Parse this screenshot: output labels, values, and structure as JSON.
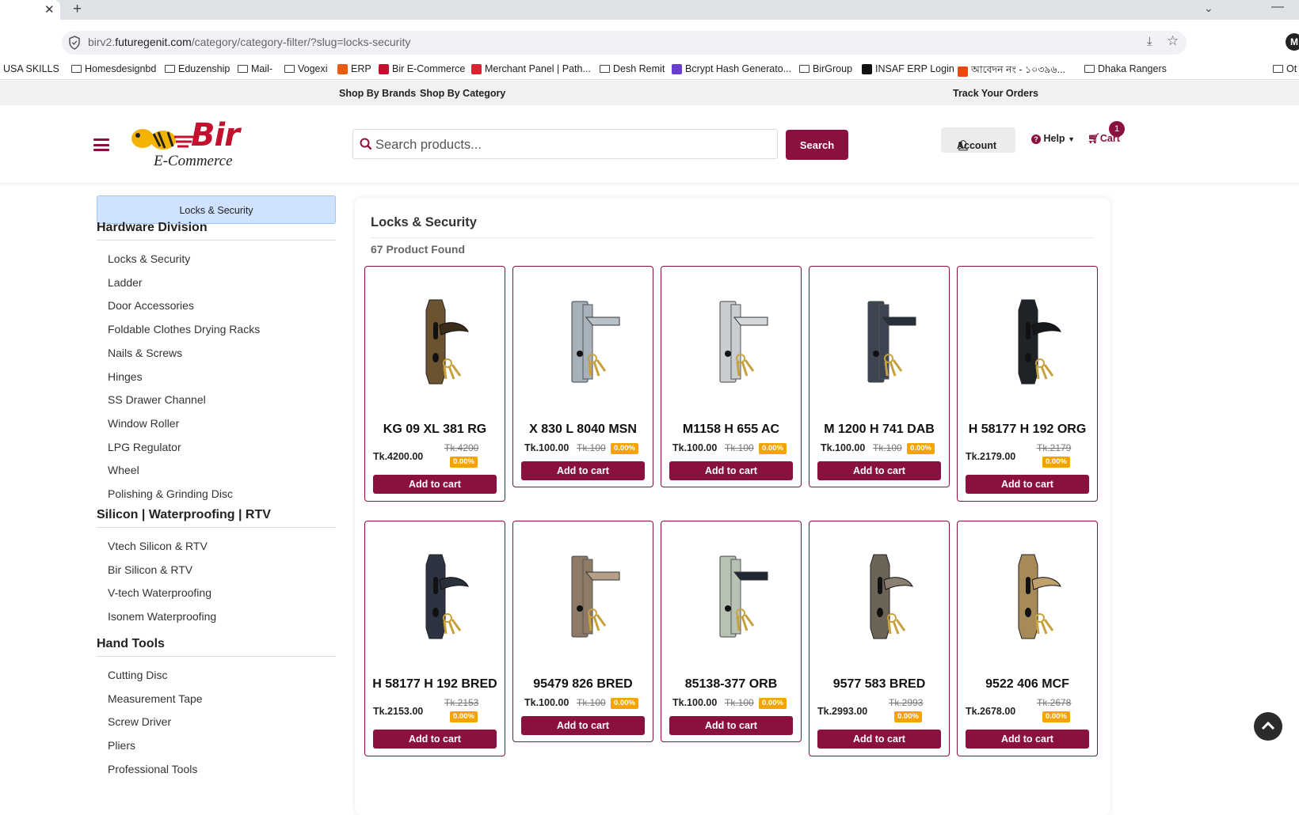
{
  "browser": {
    "url_prefix": "birv2.",
    "url_domain": "futuregenit.com",
    "url_path": "/category/category-filter/?slug=locks-security",
    "profile_initial": "M",
    "bookmarks": [
      {
        "label": "USA SKILLS",
        "type": "none"
      },
      {
        "label": "Homesdesignbd",
        "type": "folder"
      },
      {
        "label": "Eduzenship",
        "type": "folder"
      },
      {
        "label": "Mail-",
        "type": "folder"
      },
      {
        "label": "Vogexi",
        "type": "folder"
      },
      {
        "label": "ERP",
        "type": "icon",
        "color": "#e85c0d"
      },
      {
        "label": "Bir E-Commerce",
        "type": "icon",
        "color": "#c4102e"
      },
      {
        "label": "Merchant Panel | Path...",
        "type": "icon",
        "color": "#d9232e"
      },
      {
        "label": "Desh Remit",
        "type": "folder"
      },
      {
        "label": "Bcrypt Hash Generato...",
        "type": "icon",
        "color": "#6a3fd0"
      },
      {
        "label": "BirGroup",
        "type": "folder"
      },
      {
        "label": "INSAF ERP Login",
        "type": "icon",
        "color": "#111111"
      },
      {
        "label": "আবেদন নং - ১০৩৯৬...",
        "type": "icon",
        "color": "#e8490f"
      },
      {
        "label": "Dhaka Rangers",
        "type": "folder"
      },
      {
        "label": "Ot",
        "type": "folder"
      }
    ]
  },
  "topbar": {
    "brands": "Shop By Brands",
    "category": "Shop By Category",
    "track": "Track Your Orders"
  },
  "header": {
    "logo_text": "Bir",
    "logo_sub": "E-Commerce",
    "search_placeholder": "Search products...",
    "search_button": "Search",
    "account": "Account",
    "help": "Help",
    "cart": "Cart",
    "cart_count": "1"
  },
  "sidebar": {
    "crumb": "Locks & Security",
    "sections": [
      {
        "title": "Hardware Division",
        "items": [
          "Locks & Security",
          "Ladder",
          "Door Accessories",
          "Foldable Clothes Drying Racks",
          "Nails & Screws",
          "Hinges",
          "SS Drawer Channel",
          "Window Roller",
          "LPG Regulator",
          "Wheel",
          "Polishing & Grinding Disc"
        ]
      },
      {
        "title": "Silicon | Waterproofing | RTV",
        "items": [
          "Vtech Silicon & RTV",
          "Bir Silicon & RTV",
          "V-tech Waterproofing",
          "Isonem Waterproofing"
        ]
      },
      {
        "title": "Hand Tools",
        "items": [
          "Cutting Disc",
          "Measurement Tape",
          "Screw Driver",
          "Pliers",
          "Professional Tools"
        ]
      }
    ]
  },
  "main": {
    "title": "Locks & Security",
    "count": "67 Product Found",
    "add_label": "Add to cart",
    "products": [
      {
        "name": "KG 09 XL 381 RG",
        "price": "Tk.4200.00",
        "old": "Tk.4200",
        "disc": "0.00%",
        "style": "tall",
        "metal": "#6b5330",
        "handle": "#3a2c18"
      },
      {
        "name": "X 830 L 8040 MSN",
        "price": "Tk.100.00",
        "old": "Tk.100",
        "disc": "0.00%",
        "style": "inline",
        "metal": "#a7b1bb",
        "handle": "#b9c2ca"
      },
      {
        "name": "M1158 H 655 AC",
        "price": "Tk.100.00",
        "old": "Tk.100",
        "disc": "0.00%",
        "style": "inline",
        "metal": "#c9cdd1",
        "handle": "#d6d9dc"
      },
      {
        "name": "M 1200 H 741 DAB",
        "price": "Tk.100.00",
        "old": "Tk.100",
        "disc": "0.00%",
        "style": "inline",
        "metal": "#3d4452",
        "handle": "#2a303b"
      },
      {
        "name": "H 58177 H 192 ORG",
        "price": "Tk.2179.00",
        "old": "Tk.2179",
        "disc": "0.00%",
        "style": "tall",
        "metal": "#1f2328",
        "handle": "#15181c"
      },
      {
        "name": "H 58177 H 192 BRED",
        "price": "Tk.2153.00",
        "old": "Tk.2153",
        "disc": "0.00%",
        "style": "tall",
        "metal": "#2d3340",
        "handle": "#2a303b"
      },
      {
        "name": "95479 826 BRED",
        "price": "Tk.100.00",
        "old": "Tk.100",
        "disc": "0.00%",
        "style": "inline",
        "metal": "#8e7a66",
        "handle": "#b59f86"
      },
      {
        "name": "85138-377 ORB",
        "price": "Tk.100.00",
        "old": "Tk.100",
        "disc": "0.00%",
        "style": "inline",
        "metal": "#b8c2b2",
        "handle": "#222833"
      },
      {
        "name": "9577 583 BRED",
        "price": "Tk.2993.00",
        "old": "Tk.2993",
        "disc": "0.00%",
        "style": "tall",
        "metal": "#6d6458",
        "handle": "#8a7f70"
      },
      {
        "name": "9522 406 MCF",
        "price": "Tk.2678.00",
        "old": "Tk.2678",
        "disc": "0.00%",
        "style": "tall",
        "metal": "#a88958",
        "handle": "#c0a06c"
      }
    ]
  }
}
